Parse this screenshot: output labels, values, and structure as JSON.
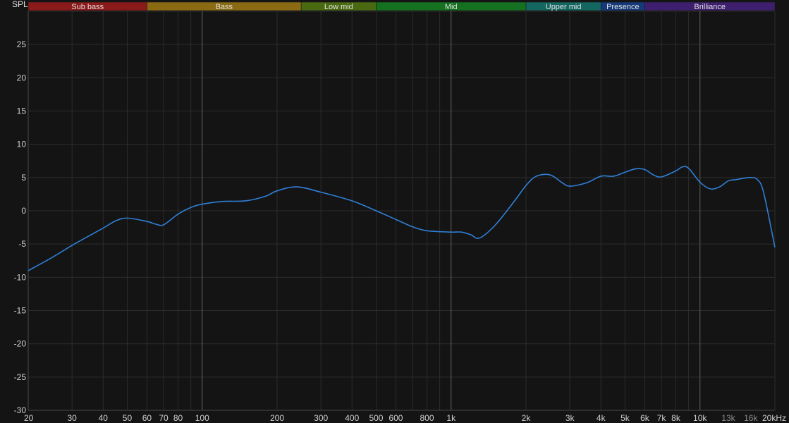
{
  "chart_data": {
    "type": "line",
    "ylabel": "SPL",
    "x_unit_label": "20kHz",
    "x_scale": "log",
    "xlim": [
      20,
      20000
    ],
    "ylim": [
      -30,
      30
    ],
    "grid": true,
    "colors": {
      "background": "#141414",
      "grid": "#2c2c2c",
      "grid_major": "#565656",
      "line": "#2f7fd6"
    },
    "bands": [
      {
        "label": "Sub bass",
        "from": 20,
        "to": 60,
        "color": "#8b1a1a"
      },
      {
        "label": "Bass",
        "from": 60,
        "to": 250,
        "color": "#8a6a12"
      },
      {
        "label": "Low mid",
        "from": 250,
        "to": 500,
        "color": "#4a6a12"
      },
      {
        "label": "Mid",
        "from": 500,
        "to": 2000,
        "color": "#15701f"
      },
      {
        "label": "Upper mid",
        "from": 2000,
        "to": 4000,
        "color": "#146660"
      },
      {
        "label": "Presence",
        "from": 4000,
        "to": 6000,
        "color": "#163a78"
      },
      {
        "label": "Brilliance",
        "from": 6000,
        "to": 20000,
        "color": "#3e1f6e"
      }
    ],
    "y_ticks": [
      25,
      20,
      15,
      10,
      5,
      0,
      -5,
      -10,
      -15,
      -20,
      -25,
      -30
    ],
    "x_ticks": [
      {
        "value": 20,
        "label": "20"
      },
      {
        "value": 30,
        "label": "30"
      },
      {
        "value": 40,
        "label": "40"
      },
      {
        "value": 50,
        "label": "50"
      },
      {
        "value": 60,
        "label": "60"
      },
      {
        "value": 70,
        "label": "70"
      },
      {
        "value": 80,
        "label": "80"
      },
      {
        "value": 100,
        "label": "100"
      },
      {
        "value": 200,
        "label": "200"
      },
      {
        "value": 300,
        "label": "300"
      },
      {
        "value": 400,
        "label": "400"
      },
      {
        "value": 500,
        "label": "500"
      },
      {
        "value": 600,
        "label": "600"
      },
      {
        "value": 800,
        "label": "800"
      },
      {
        "value": 1000,
        "label": "1k"
      },
      {
        "value": 2000,
        "label": "2k"
      },
      {
        "value": 3000,
        "label": "3k"
      },
      {
        "value": 4000,
        "label": "4k"
      },
      {
        "value": 5000,
        "label": "5k"
      },
      {
        "value": 6000,
        "label": "6k"
      },
      {
        "value": 7000,
        "label": "7k"
      },
      {
        "value": 8000,
        "label": "8k"
      },
      {
        "value": 10000,
        "label": "10k"
      },
      {
        "value": 13000,
        "label": "13k",
        "dim": true
      },
      {
        "value": 16000,
        "label": "16k",
        "dim": true
      }
    ],
    "minor_grid_x": [
      20,
      30,
      40,
      50,
      60,
      70,
      80,
      90,
      100,
      200,
      300,
      400,
      500,
      600,
      700,
      800,
      900,
      1000,
      2000,
      3000,
      4000,
      5000,
      6000,
      7000,
      8000,
      9000,
      10000,
      20000
    ],
    "major_grid_x": [
      100,
      1000,
      10000
    ],
    "series": [
      {
        "x": [
          20,
          25,
          30,
          35,
          40,
          45,
          50,
          60,
          65,
          70,
          80,
          90,
          100,
          120,
          150,
          180,
          200,
          240,
          300,
          400,
          500,
          600,
          700,
          800,
          1000,
          1100,
          1200,
          1300,
          1500,
          1800,
          2000,
          2200,
          2500,
          2800,
          3000,
          3500,
          4000,
          4500,
          5000,
          5500,
          6000,
          6500,
          7000,
          8000,
          8500,
          9000,
          10000,
          11000,
          12000,
          13000,
          14000,
          15000,
          16000,
          17000,
          18000,
          20000
        ],
        "y": [
          -9.0,
          -7.0,
          -5.2,
          -3.8,
          -2.6,
          -1.5,
          -1.1,
          -1.6,
          -2.0,
          -2.1,
          -0.5,
          0.5,
          1.0,
          1.4,
          1.5,
          2.2,
          3.0,
          3.6,
          2.8,
          1.5,
          0.0,
          -1.3,
          -2.4,
          -3.0,
          -3.2,
          -3.2,
          -3.6,
          -4.1,
          -2.2,
          1.5,
          3.8,
          5.2,
          5.4,
          4.2,
          3.7,
          4.2,
          5.2,
          5.2,
          5.8,
          6.3,
          6.2,
          5.4,
          5.1,
          6.0,
          6.6,
          6.4,
          4.3,
          3.3,
          3.6,
          4.5,
          4.7,
          4.9,
          5.0,
          4.7,
          2.8,
          -5.5
        ]
      }
    ]
  }
}
